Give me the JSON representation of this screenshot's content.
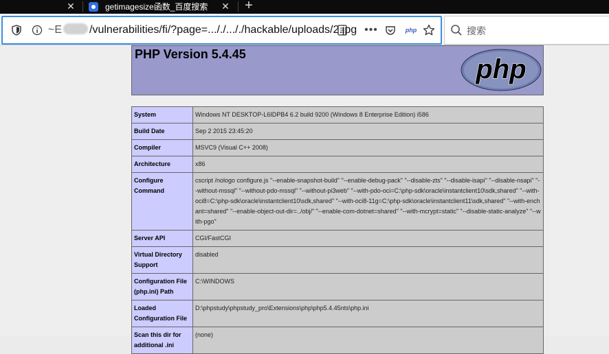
{
  "tabs": {
    "active_title": "getimagesize函数_百度搜索",
    "close_glyph": "✕",
    "new_tab_glyph": "+"
  },
  "urlbar": {
    "url": "/vulnerabilities/fi/?page=..././..././hackable/uploads/2.jpg",
    "prefix": "~E"
  },
  "search": {
    "placeholder": "搜索"
  },
  "phpinfo": {
    "title": "PHP Version 5.4.45",
    "rows": [
      {
        "key": "System",
        "value": "Windows NT DESKTOP-L6IDPB4 6.2 build 9200 (Windows 8 Enterprise Edition) i586"
      },
      {
        "key": "Build Date",
        "value": "Sep 2 2015 23:45:20"
      },
      {
        "key": "Compiler",
        "value": "MSVC9 (Visual C++ 2008)"
      },
      {
        "key": "Architecture",
        "value": "x86"
      },
      {
        "key": "Configure Command",
        "value": "cscript /nologo configure.js \"--enable-snapshot-build\" \"--enable-debug-pack\" \"--disable-zts\" \"--disable-isapi\" \"--disable-nsapi\" \"--without-mssql\" \"--without-pdo-mssql\" \"--without-pi3web\" \"--with-pdo-oci=C:\\php-sdk\\oracle\\instantclient10\\sdk,shared\" \"--with-oci8=C:\\php-sdk\\oracle\\instantclient10\\sdk,shared\" \"--with-oci8-11g=C:\\php-sdk\\oracle\\instantclient11\\sdk,shared\" \"--with-enchant=shared\" \"--enable-object-out-dir=../obj/\" \"--enable-com-dotnet=shared\" \"--with-mcrypt=static\" \"--disable-static-analyze\" \"--with-pgo\""
      },
      {
        "key": "Server API",
        "value": "CGI/FastCGI"
      },
      {
        "key": "Virtual Directory Support",
        "value": "disabled"
      },
      {
        "key": "Configuration File (php.ini) Path",
        "value": "C:\\WINDOWS"
      },
      {
        "key": "Loaded Configuration File",
        "value": "D:\\phpstudy\\phpstudy_pro\\Extensions\\php\\php5.4.45nts\\php.ini"
      },
      {
        "key": "Scan this dir for additional .ini",
        "value": "(none)"
      }
    ]
  },
  "logo_text": "php",
  "ext_label": "php",
  "colors": {
    "header_bg": "#9999cc",
    "key_bg": "#ccccff",
    "value_bg": "#cccccc",
    "focus_ring": "#3b8ee6"
  }
}
